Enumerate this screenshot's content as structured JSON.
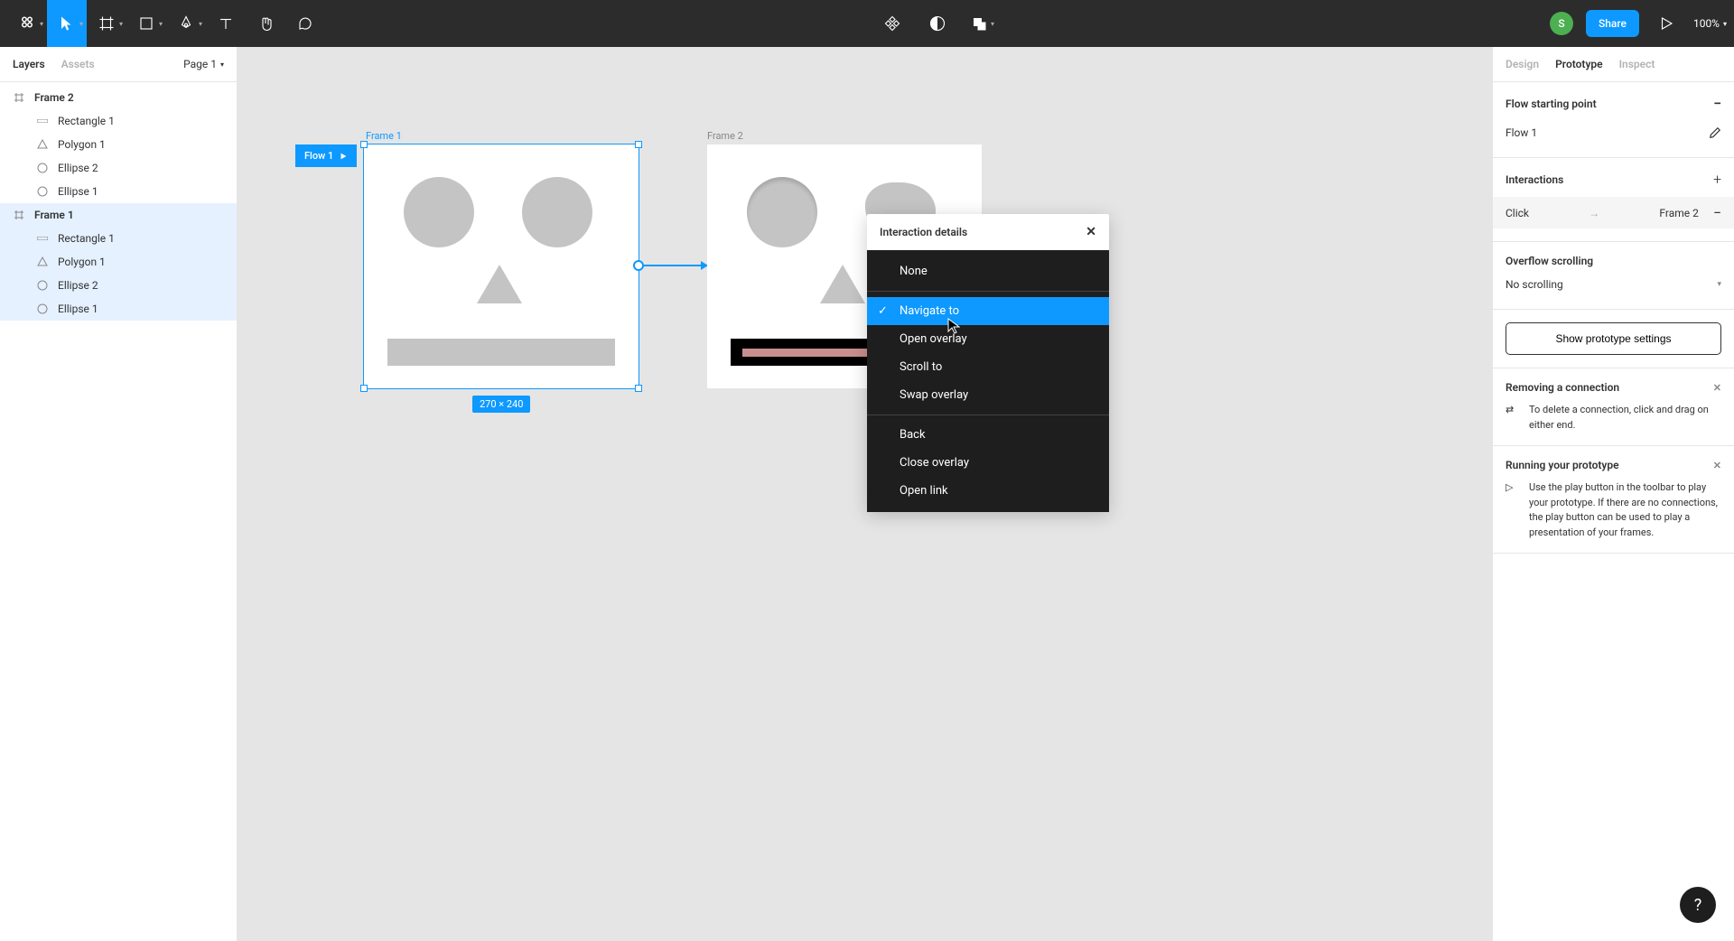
{
  "toolbar": {
    "share_label": "Share",
    "zoom": "100%",
    "avatar_initial": "S"
  },
  "left_panel": {
    "tabs": {
      "layers": "Layers",
      "assets": "Assets"
    },
    "page_selector": "Page 1",
    "layers": [
      {
        "name": "Frame 2",
        "type": "frame",
        "selected": false
      },
      {
        "name": "Rectangle 1",
        "type": "rect",
        "child": true
      },
      {
        "name": "Polygon 1",
        "type": "polygon",
        "child": true
      },
      {
        "name": "Ellipse 2",
        "type": "ellipse",
        "child": true
      },
      {
        "name": "Ellipse 1",
        "type": "ellipse",
        "child": true
      },
      {
        "name": "Frame 1",
        "type": "frame",
        "selected": true
      },
      {
        "name": "Rectangle 1",
        "type": "rect",
        "child": true
      },
      {
        "name": "Polygon 1",
        "type": "polygon",
        "child": true
      },
      {
        "name": "Ellipse 2",
        "type": "ellipse",
        "child": true
      },
      {
        "name": "Ellipse 1",
        "type": "ellipse",
        "child": true
      }
    ]
  },
  "canvas": {
    "frame1_label": "Frame 1",
    "frame2_label": "Frame 2",
    "flow_badge": "Flow 1",
    "size_badge": "270 × 240"
  },
  "interaction_popup": {
    "title": "Interaction details",
    "options": {
      "none": "None",
      "navigate": "Navigate to",
      "open_overlay": "Open overlay",
      "scroll_to": "Scroll to",
      "swap_overlay": "Swap overlay",
      "back": "Back",
      "close_overlay": "Close overlay",
      "open_link": "Open link"
    }
  },
  "right_panel": {
    "tabs": {
      "design": "Design",
      "prototype": "Prototype",
      "inspect": "Inspect"
    },
    "flow_section": {
      "title": "Flow starting point",
      "value": "Flow 1"
    },
    "interactions_section": {
      "title": "Interactions",
      "trigger": "Click",
      "target": "Frame 2"
    },
    "overflow_section": {
      "title": "Overflow scrolling",
      "value": "No scrolling"
    },
    "settings_btn": "Show prototype settings",
    "removing_section": {
      "title": "Removing a connection",
      "text": "To delete a connection, click and drag on either end."
    },
    "running_section": {
      "title": "Running your prototype",
      "text": "Use the play button in the toolbar to play your prototype. If there are no connections, the play button can be used to play a presentation of your frames."
    }
  }
}
